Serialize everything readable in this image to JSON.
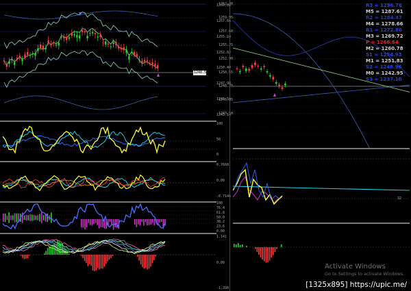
{
  "colors": {
    "bull": "#21d42a",
    "bear": "#ff3b3b",
    "yellow": "#ffff33",
    "blue": "#2f6bff",
    "cyan": "#22cfe6",
    "magenta": "#cc33cc",
    "grey": "#9a9a9a",
    "white": "#ffffff",
    "level_blue": "#1f3fff",
    "level_grey": "#d0d0d0",
    "level_red": "#ff2020",
    "level_dark": "#2a3db0"
  },
  "left_price_axis": {
    "labels": [
      "1260.08",
      "1257.66",
      "1255.24",
      "1252.82",
      "1250.40",
      "1247.98",
      "1245.56",
      "1243.14"
    ],
    "current_price": "1248.55"
  },
  "left_osc1_axis": {
    "labels": [
      "100",
      "50",
      "0"
    ]
  },
  "left_osc2_axis": {
    "labels": [
      "0.7668",
      "0.00",
      "-0.7146"
    ]
  },
  "left_osc3_axis": {
    "labels": [
      "100",
      "76.4",
      "61.8",
      "50.0",
      "38.2",
      "23.6",
      "0.00"
    ]
  },
  "left_osc4_axis": {
    "labels": [
      "1.141",
      "0.00",
      "-1.398"
    ]
  },
  "right_price_axis": {
    "labels": [
      "1262.30",
      "1259.95",
      "1257.60",
      "1255.25",
      "1252.90",
      "1250.55",
      "1248.20",
      "1245.85",
      "1243.50"
    ]
  },
  "right_osc1_axis": {
    "labels": [
      "32"
    ]
  },
  "pivot_levels": [
    {
      "label": "R3 = 1296.76",
      "tone": "level_blue"
    },
    {
      "label": "M5 = 1287.61",
      "tone": "level_grey"
    },
    {
      "label": "R2 = 1284.47",
      "tone": "level_dark"
    },
    {
      "label": "M4 = 1278.66",
      "tone": "level_grey"
    },
    {
      "label": "R1 = 1272.86",
      "tone": "level_blue"
    },
    {
      "label": "M3 = 1269.72",
      "tone": "level_grey"
    },
    {
      "label": "P   = 1266.64",
      "tone": "level_red"
    },
    {
      "label": "M2 = 1260.78",
      "tone": "level_grey"
    },
    {
      "label": "S1 = 1254.93",
      "tone": "level_blue"
    },
    {
      "label": "M1 = 1251.83",
      "tone": "level_grey"
    },
    {
      "label": "S2 = 1248.96",
      "tone": "level_blue"
    },
    {
      "label": "M0 = 1242.95",
      "tone": "level_grey"
    },
    {
      "label": "S3 = 1237.10",
      "tone": "level_blue"
    }
  ],
  "watermark": {
    "title": "Activate Windows",
    "subtitle": "Go to Settings to activate Windows."
  },
  "credit": "[1325x895] https://upic.me/"
}
